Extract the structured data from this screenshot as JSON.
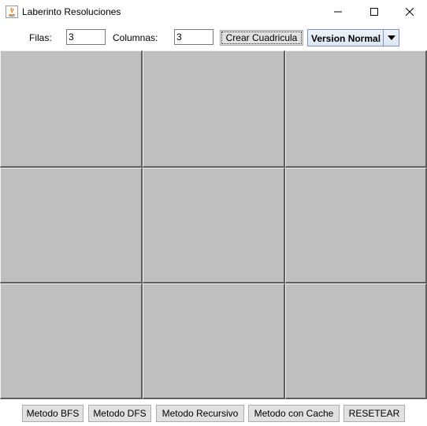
{
  "window": {
    "title": "Laberinto Resoluciones",
    "icon": "java-icon"
  },
  "toolbar": {
    "filas_label": "Filas:",
    "filas_value": "3",
    "columnas_label": "Columnas:",
    "columnas_value": "3",
    "crear_button": "Crear Cuadricula",
    "version_select": "Version Normal"
  },
  "grid": {
    "rows": 3,
    "columns": 3,
    "cell_color": "#bfbfbf"
  },
  "bottom": {
    "bfs_button": "Metodo BFS",
    "dfs_button": "Metodo DFS",
    "recursivo_button": "Metodo Recursivo",
    "cache_button": "Metodo con Cache",
    "reset_button": "RESETEAR"
  }
}
